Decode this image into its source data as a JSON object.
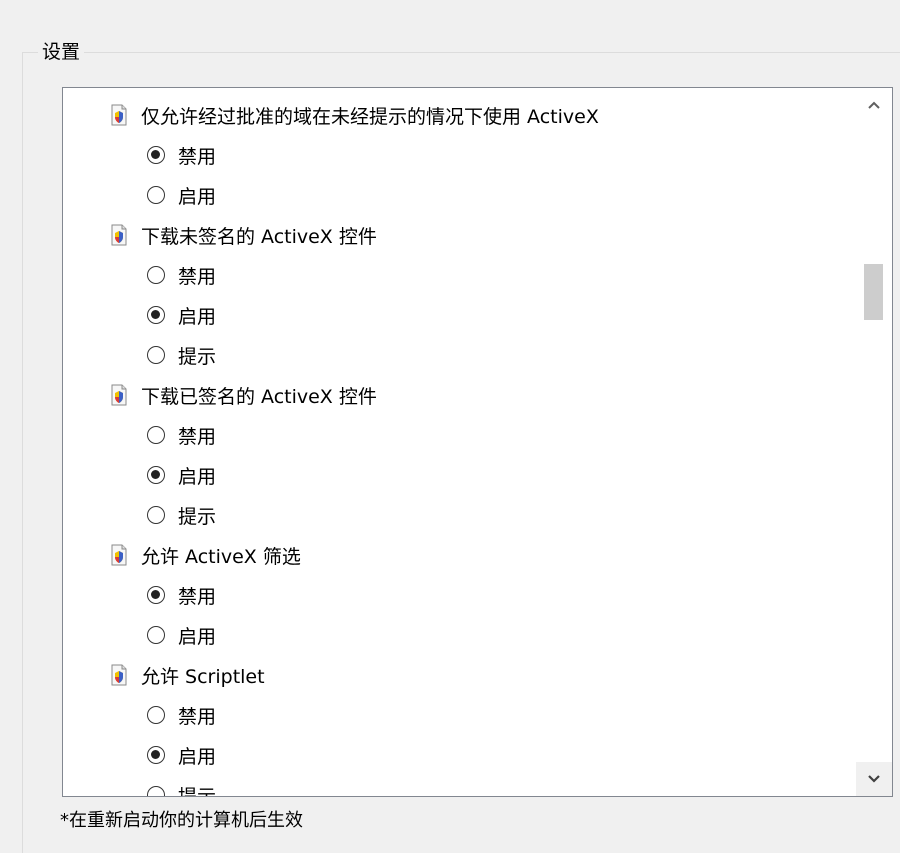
{
  "group_title": "设置",
  "settings": [
    {
      "label": "仅允许经过批准的域在未经提示的情况下使用 ActiveX",
      "options": [
        {
          "label": "禁用",
          "checked": true
        },
        {
          "label": "启用",
          "checked": false
        }
      ]
    },
    {
      "label": "下载未签名的 ActiveX 控件",
      "options": [
        {
          "label": "禁用",
          "checked": false
        },
        {
          "label": "启用",
          "checked": true
        },
        {
          "label": "提示",
          "checked": false
        }
      ]
    },
    {
      "label": "下载已签名的 ActiveX 控件",
      "options": [
        {
          "label": "禁用",
          "checked": false
        },
        {
          "label": "启用",
          "checked": true
        },
        {
          "label": "提示",
          "checked": false
        }
      ]
    },
    {
      "label": "允许 ActiveX 筛选",
      "options": [
        {
          "label": "禁用",
          "checked": true
        },
        {
          "label": "启用",
          "checked": false
        }
      ]
    },
    {
      "label": "允许 Scriptlet",
      "options": [
        {
          "label": "禁用",
          "checked": false
        },
        {
          "label": "启用",
          "checked": true
        },
        {
          "label": "提示",
          "checked": false
        }
      ]
    }
  ],
  "footer_note": "*在重新启动你的计算机后生效",
  "scroll_position": 0.3,
  "icons": {
    "setting": "settings-page-icon",
    "scroll_up": "chevron-up-icon",
    "scroll_down": "chevron-down-icon"
  }
}
